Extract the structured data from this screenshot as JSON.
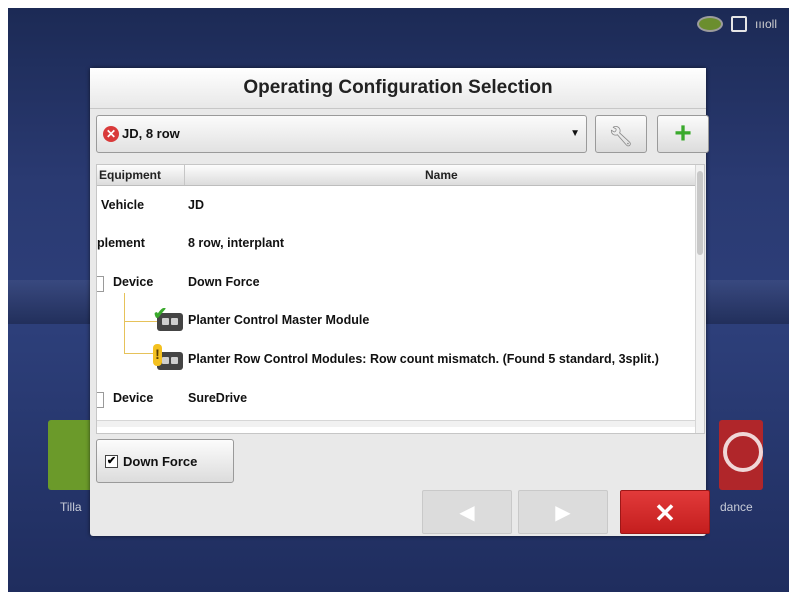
{
  "status_bar": {
    "signal_text": "ıııoll"
  },
  "background_tiles": {
    "left_label": "Tilla",
    "right_label": "dance"
  },
  "dialog": {
    "title": "Operating Configuration Selection",
    "configuration_select": {
      "value": "JD, 8 row",
      "status_icon": "error-icon"
    },
    "tree": {
      "headers": {
        "equipment": "Equipment",
        "name": "Name"
      },
      "rows": [
        {
          "equipment": "Vehicle",
          "name": "JD"
        },
        {
          "equipment": "plement",
          "name": "8 row, interplant"
        },
        {
          "equipment": "Device",
          "name": "Down Force"
        },
        {
          "equipment": "",
          "name": "Planter Control Master Module",
          "status_icon": "check-icon"
        },
        {
          "equipment": "",
          "name": "Planter Row Control Modules: Row count mismatch. (Found 5 standard, 3split.)",
          "status_icon": "warning-icon"
        },
        {
          "equipment": "Device",
          "name": "SureDrive"
        }
      ]
    },
    "down_force_checkbox": {
      "label": "Down Force",
      "checked": true,
      "mark": "✔"
    },
    "nav": {
      "prev": "◀",
      "next": "▶",
      "close": "✕"
    }
  },
  "colors": {
    "accent_green": "#3aa92c",
    "close_red": "#d32a2a",
    "error_red": "#d93a3a",
    "warning_yellow": "#f4c120"
  }
}
